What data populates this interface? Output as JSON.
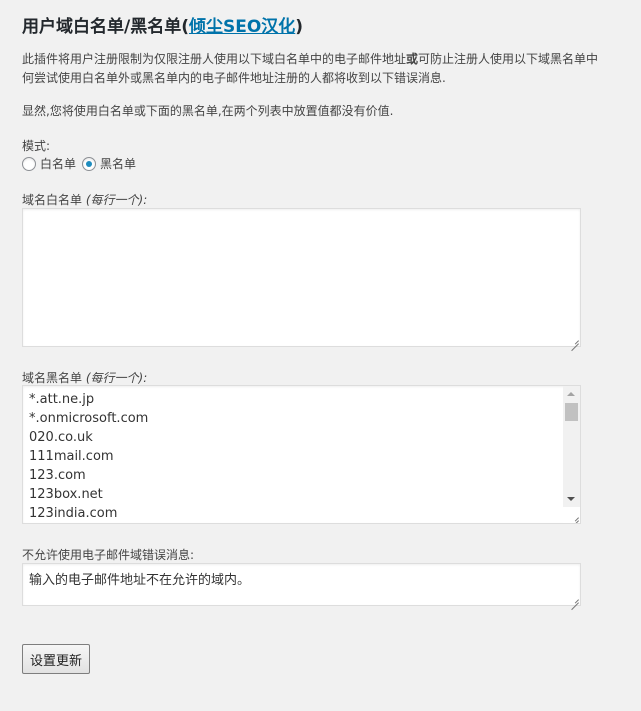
{
  "title": {
    "prefix": "用户域白名单/黑名单(",
    "link": "倾尘SEO汉化",
    "suffix": ")"
  },
  "description": {
    "line1_before": "此插件将用户注册限制为仅限注册人使用以下域白名单中的电子邮件地址",
    "line1_bold": "或",
    "line1_after": "可防止注册人使用以下域黑名单中",
    "line2": "何尝试使用白名单外或黑名单内的电子邮件地址注册的人都将收到以下错误消息."
  },
  "note": "显然,您将使用白名单或下面的黑名单,在两个列表中放置值都没有价值.",
  "mode": {
    "label": "模式:",
    "options": [
      {
        "label": "白名单",
        "checked": false
      },
      {
        "label": "黑名单",
        "checked": true
      }
    ]
  },
  "whitelist": {
    "label": "域名白名单",
    "hint": "(每行一个):",
    "value": ""
  },
  "blacklist": {
    "label": "域名黑名单",
    "hint": "(每行一个):",
    "items": [
      "*.att.ne.jp",
      "*.onmicrosoft.com",
      "020.co.uk",
      "111mail.com",
      "123.com",
      "123box.net",
      "123india.com"
    ]
  },
  "error_message": {
    "label": "不允许使用电子邮件域错误消息:",
    "value": "输入的电子邮件地址不在允许的域内。"
  },
  "submit_label": "设置更新",
  "colors": {
    "link": "#0073aa",
    "background": "#f1f1f1",
    "radio_checked": "#1e8cbe"
  }
}
